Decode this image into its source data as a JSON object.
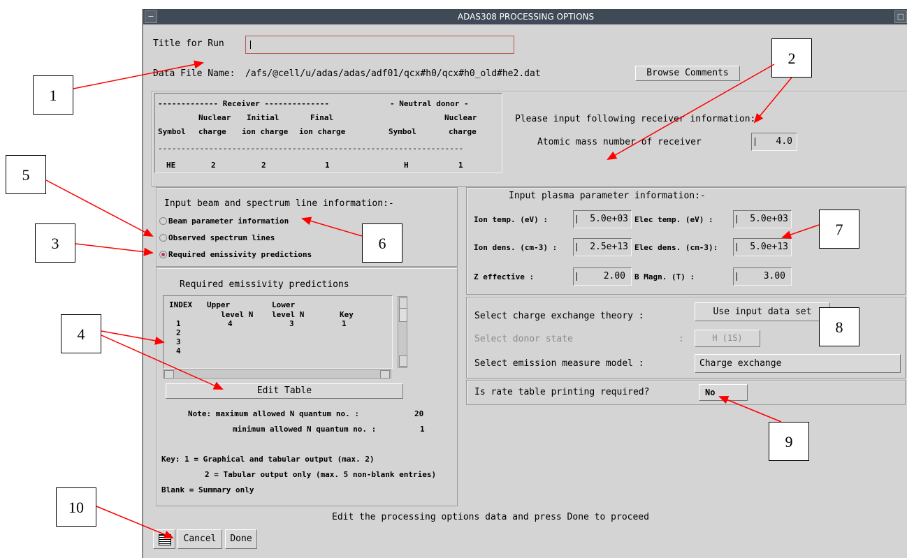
{
  "window": {
    "title": "ADAS308 PROCESSING OPTIONS"
  },
  "run": {
    "title_label": "Title for Run",
    "title_value": ""
  },
  "datafile": {
    "label": "Data File Name:",
    "path": "/afs/@cell/u/adas/adas/adf01/qcx#h0/qcx#h0_old#he2.dat",
    "browse_label": "Browse Comments"
  },
  "receiver_table": {
    "group_receiver": "------------- Receiver --------------",
    "group_donor": "- Neutral donor -",
    "head_row1": [
      "",
      "Nuclear",
      "Initial",
      "Final",
      "",
      "Nuclear"
    ],
    "head_row2": [
      "Symbol",
      "charge",
      "ion charge",
      "ion charge",
      "Symbol",
      "charge"
    ],
    "dashes": "------------------------------------------------------------------",
    "values": [
      "HE",
      "2",
      "2",
      "1",
      "H",
      "1"
    ]
  },
  "receiver_info": {
    "prompt": "Please input following receiver information:-",
    "mass_label": "Atomic mass number of receiver",
    "mass_value": "4.0"
  },
  "beam": {
    "title": "Input beam and spectrum line information:-",
    "options": [
      {
        "label": "Beam parameter information",
        "selected": false
      },
      {
        "label": "Observed spectrum lines",
        "selected": false
      },
      {
        "label": "Required emissivity predictions",
        "selected": true
      }
    ]
  },
  "plasma": {
    "title": "Input plasma parameter information:-",
    "ion_temp_label": "Ion temp. (eV)   :",
    "ion_temp": "5.0e+03",
    "elec_temp_label": "Elec temp. (eV)  :",
    "elec_temp": "5.0e+03",
    "ion_dens_label": "Ion dens. (cm-3) :",
    "ion_dens": "2.5e+13",
    "elec_dens_label": "Elec dens. (cm-3):",
    "elec_dens": "5.0e+13",
    "zeff_label": "Z effective      :",
    "zeff": "2.00",
    "bmag_label": "B Magn. (T)      :",
    "bmag": "3.00"
  },
  "emissivity": {
    "title": "Required emissivity predictions",
    "headers1": [
      "INDEX",
      "Upper",
      "Lower",
      ""
    ],
    "headers2": [
      "",
      "level N",
      "level N",
      "Key"
    ],
    "rows": [
      {
        "index": "1",
        "upper": "4",
        "lower": "3",
        "key": "1"
      },
      {
        "index": "2",
        "upper": "",
        "lower": "",
        "key": ""
      },
      {
        "index": "3",
        "upper": "",
        "lower": "",
        "key": ""
      },
      {
        "index": "4",
        "upper": "",
        "lower": "",
        "key": ""
      }
    ],
    "edit_label": "Edit Table",
    "note_max": "Note: maximum allowed N quantum no. :",
    "note_max_val": "20",
    "note_min": "minimum allowed N quantum no. :",
    "note_min_val": "1",
    "key1": "Key: 1 = Graphical and tabular output (max. 2)",
    "key2": "2 = Tabular output only (max. 5 non-blank entries)",
    "key3": "Blank = Summary only"
  },
  "cx": {
    "theory_label": "Select charge exchange theory :",
    "theory_button": "Use input data set",
    "donor_label": "Select donor state",
    "donor_colon": ":",
    "donor_button": "H (1S)",
    "emission_label": "Select emission measure model :",
    "emission_button": "Charge exchange"
  },
  "rate": {
    "label": "Is rate table printing required?",
    "button": "No"
  },
  "footer": {
    "message": "Edit the processing options data and press Done to proceed",
    "cancel": "Cancel",
    "done": "Done"
  },
  "callouts": [
    "1",
    "2",
    "3",
    "4",
    "5",
    "6",
    "7",
    "8",
    "9",
    "10"
  ],
  "colors": {
    "arrow": "#ff0000",
    "panel": "#d4d4d4",
    "titlebar": "#3f4a56",
    "radio_selected": "#c0306a"
  }
}
